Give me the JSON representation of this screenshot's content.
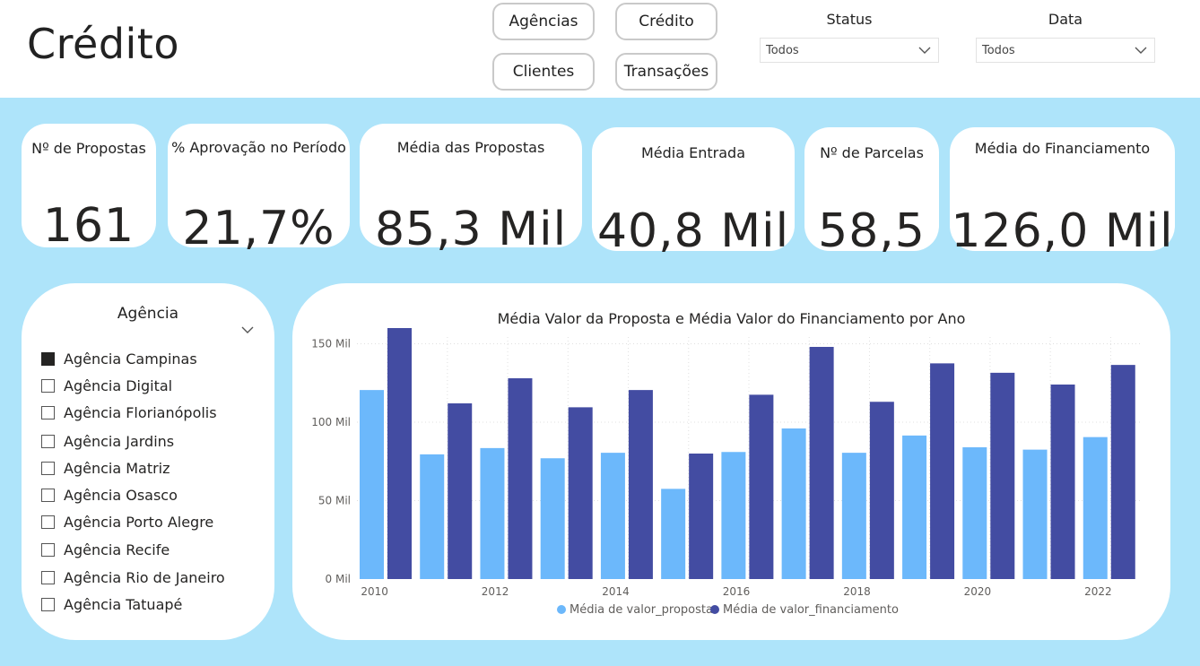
{
  "header": {
    "title": "Crédito",
    "nav": [
      "Agências",
      "Crédito",
      "Clientes",
      "Transações"
    ],
    "filters": [
      {
        "label": "Status",
        "value": "Todos"
      },
      {
        "label": "Data",
        "value": "Todos"
      }
    ]
  },
  "kpis": [
    {
      "label": "Nº de Propostas",
      "value": "161"
    },
    {
      "label": "% Aprovação no Período",
      "value": "21,7%"
    },
    {
      "label": "Média das Propostas",
      "value": "85,3 Mil"
    },
    {
      "label": "Média Entrada",
      "value": "40,8 Mil"
    },
    {
      "label": "Nº de Parcelas",
      "value": "58,5"
    },
    {
      "label": "Média do Financiamento",
      "value": "126,0 Mil"
    }
  ],
  "agency_slicer": {
    "title": "Agência",
    "items": [
      {
        "label": "Agência Campinas",
        "checked": true
      },
      {
        "label": "Agência Digital",
        "checked": false
      },
      {
        "label": "Agência Florianópolis",
        "checked": false
      },
      {
        "label": "Agência Jardins",
        "checked": false
      },
      {
        "label": "Agência Matriz",
        "checked": false
      },
      {
        "label": "Agência Osasco",
        "checked": false
      },
      {
        "label": "Agência Porto Alegre",
        "checked": false
      },
      {
        "label": "Agência Recife",
        "checked": false
      },
      {
        "label": "Agência Rio de Janeiro",
        "checked": false
      },
      {
        "label": "Agência Tatuapé",
        "checked": false
      }
    ]
  },
  "colors": {
    "canvas": "#aee4fa",
    "series_proposta": "#6cb8fb",
    "series_financiamento": "#434ca2",
    "grid": "#e0e0e0"
  },
  "chart_data": {
    "type": "bar",
    "title": "Média Valor da Proposta e Média Valor do Financiamento por Ano",
    "categories": [
      2010,
      2011,
      2012,
      2013,
      2014,
      2015,
      2016,
      2017,
      2018,
      2019,
      2020,
      2021,
      2022
    ],
    "tick_labels_x": [
      "2010",
      "2012",
      "2014",
      "2016",
      "2018",
      "2020",
      "2022"
    ],
    "tick_labels_y": [
      "0 Mil",
      "50 Mil",
      "100 Mil",
      "150 Mil"
    ],
    "y_ticks": [
      0,
      50,
      100,
      150
    ],
    "ylim": [
      0,
      160
    ],
    "grid": true,
    "legend_position": "bottom",
    "series": [
      {
        "name": "Média de valor_proposta",
        "values": [
          120.5,
          79.5,
          83.5,
          77,
          80.5,
          57.5,
          81,
          96,
          80.5,
          91.5,
          84,
          82.5,
          90.5
        ]
      },
      {
        "name": "Média de valor_financiamento",
        "values": [
          160,
          112,
          128,
          109.5,
          120.5,
          80,
          117.5,
          148,
          113,
          137.5,
          131.5,
          124,
          136.5
        ]
      }
    ]
  }
}
